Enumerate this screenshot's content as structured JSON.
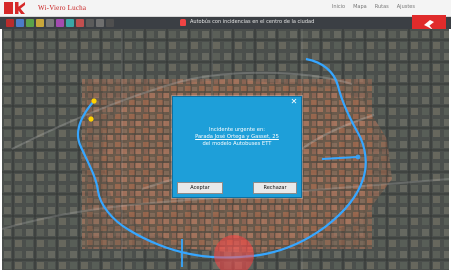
{
  "app": {
    "brand": "Wi-Viero Lucha"
  },
  "topnav": {
    "items": [
      "Inicio",
      "Mapa",
      "Rutas",
      "Ajustes"
    ]
  },
  "toolbar": {
    "description": "Autobús con incidencias en el centro de la ciudad"
  },
  "dialog": {
    "close_label": "✕",
    "message_lines": [
      "Incidente urgente en:",
      "Parada José Ortega y Gasset, 25",
      "del modelo Autobuses ETT"
    ],
    "accept_label": "Aceptar",
    "reject_label": "Rechazar"
  },
  "colors": {
    "accent_red": "#d62828",
    "dialog_blue": "#1e9fd9",
    "route_blue": "#36a6ff",
    "incident_red": "#ff3b3b"
  },
  "icons": {
    "app_logo": "logo-k-icon",
    "notification": "bell-icon",
    "corner_tile": "bird-icon"
  }
}
